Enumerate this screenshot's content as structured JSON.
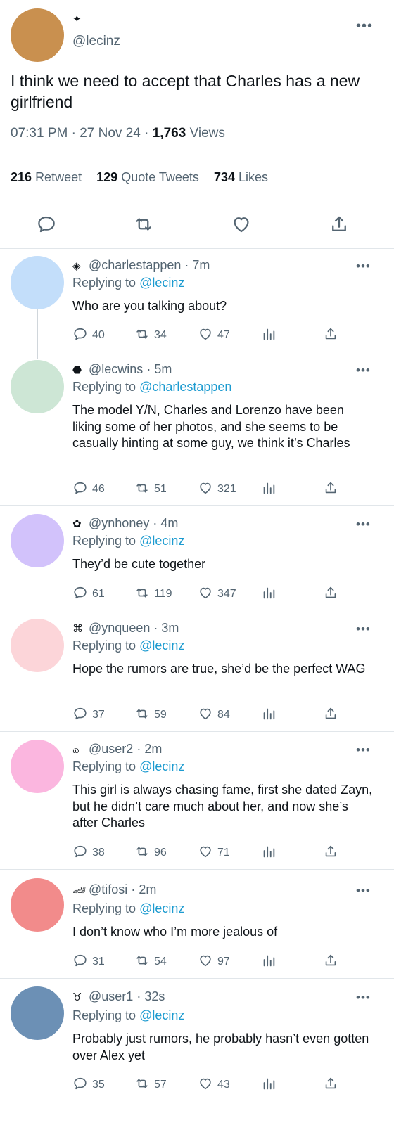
{
  "tweet": {
    "badge_icon": "sparkle-icon",
    "avatar_color": "#c9904f",
    "handle": "@lecinz",
    "text": "I think we need to accept that Charles has a new girlfriend",
    "time": "07:31 PM",
    "date": "27 Nov 24",
    "views_count": "1,763",
    "views_label": "Views",
    "retweets": "216",
    "retweets_label": "Retweet",
    "quotes": "129",
    "quotes_label": "Quote Tweets",
    "likes": "734",
    "likes_label": "Likes"
  },
  "replies": [
    {
      "icon": "◈",
      "handle": "@charlestappen",
      "time": "7m",
      "replying_label": "Replying to",
      "replying_to": "@lecinz",
      "text": "Who are you talking about?",
      "comments": "40",
      "retweets": "34",
      "likes": "47",
      "avatar_color": "#c3defa"
    },
    {
      "icon": "⬣",
      "handle": "@lecwins",
      "time": "5m",
      "replying_label": "Replying to",
      "replying_to": "@charlestappen",
      "text": "The model Y/N, Charles and Lorenzo have been liking some of her photos, and she seems to be casually hinting at some guy, we think it’s Charles",
      "comments": "46",
      "retweets": "51",
      "likes": "321",
      "avatar_color": "#cde6d5"
    },
    {
      "icon": "✿",
      "handle": "@ynhoney",
      "time": "4m",
      "replying_label": "Replying to",
      "replying_to": "@lecinz",
      "text": "They’d be cute together",
      "comments": "61",
      "retweets": "119",
      "likes": "347",
      "avatar_color": "#d2c2fb"
    },
    {
      "icon": "⌘",
      "handle": "@ynqueen",
      "time": "3m",
      "replying_label": "Replying to",
      "replying_to": "@lecinz",
      "text": "Hope the rumors are true, she’d be the perfect WAG",
      "comments": "37",
      "retweets": "59",
      "likes": "84",
      "avatar_color": "#fcd5d9"
    },
    {
      "icon": "௰",
      "handle": "@user2",
      "time": "2m",
      "replying_label": "Replying to",
      "replying_to": "@lecinz",
      "text": "This girl is always chasing fame, first she dated Zayn, but he didn’t care much about her, and now she’s after Charles",
      "comments": "38",
      "retweets": "96",
      "likes": "71",
      "avatar_color": "#fbb6df"
    },
    {
      "icon": "🏎",
      "handle": "@tifosi",
      "time": "2m",
      "replying_label": "Replying to",
      "replying_to": "@lecinz",
      "text": "I don’t know who I’m more jealous of",
      "comments": "31",
      "retweets": "54",
      "likes": "97",
      "avatar_color": "#f28b8b"
    },
    {
      "icon": "♉",
      "handle": "@user1",
      "time": "32s",
      "replying_label": "Replying to",
      "replying_to": "@lecinz",
      "text": "Probably just rumors, he probably hasn’t even gotten over Alex yet",
      "comments": "35",
      "retweets": "57",
      "likes": "43",
      "avatar_color": "#6c90b5"
    }
  ],
  "icons": {
    "more": "•••"
  },
  "colors": {
    "link": "#1d9bd0",
    "muted": "#536471",
    "text": "#0f1419",
    "divider": "#e1e6ea"
  }
}
